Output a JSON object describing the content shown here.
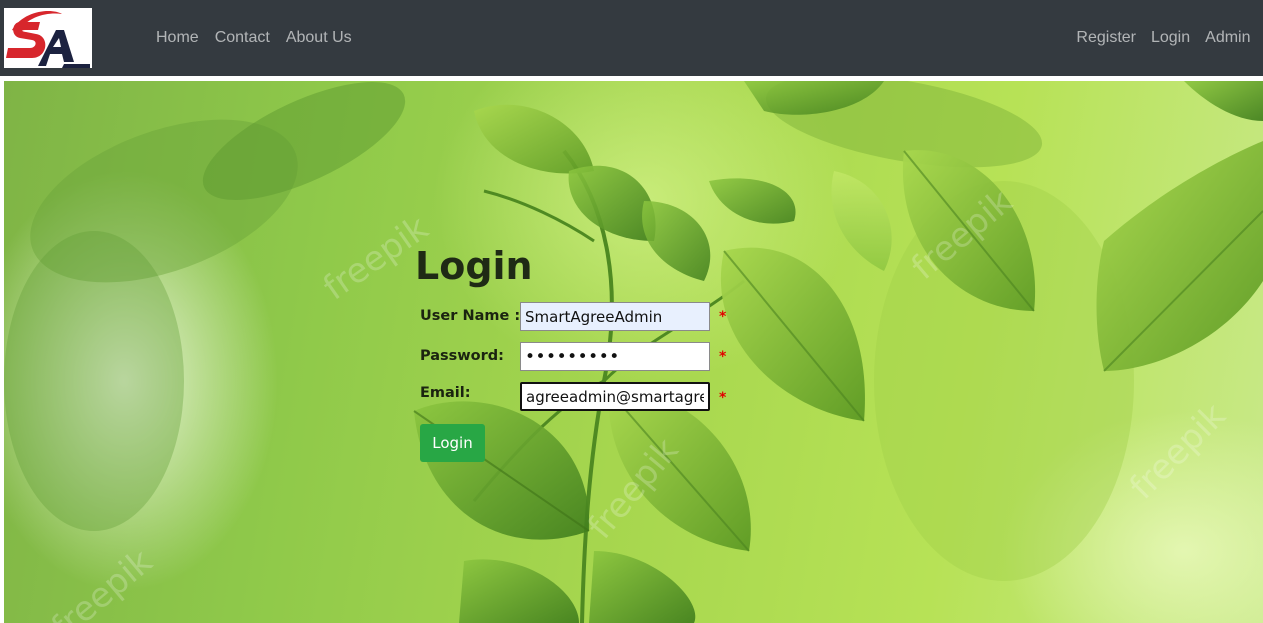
{
  "brand": {
    "logo_text": "SA",
    "colors": {
      "red": "#d7262c",
      "navy": "#1c2240"
    }
  },
  "nav": {
    "left": [
      {
        "label": "Home"
      },
      {
        "label": "Contact"
      },
      {
        "label": "About Us"
      }
    ],
    "right": [
      {
        "label": "Register"
      },
      {
        "label": "Login"
      },
      {
        "label": "Admin"
      }
    ]
  },
  "form": {
    "title": "Login",
    "username": {
      "label": "User Name :",
      "value": "SmartAgreeAdmin"
    },
    "password": {
      "label": "Password:",
      "value": "•••••••••"
    },
    "email": {
      "label": "Email:",
      "value": "agreeadmin@smartagree."
    },
    "required_mark": "*",
    "submit_label": "Login"
  },
  "background": {
    "watermark": "freepik",
    "accent": "#28a745"
  }
}
